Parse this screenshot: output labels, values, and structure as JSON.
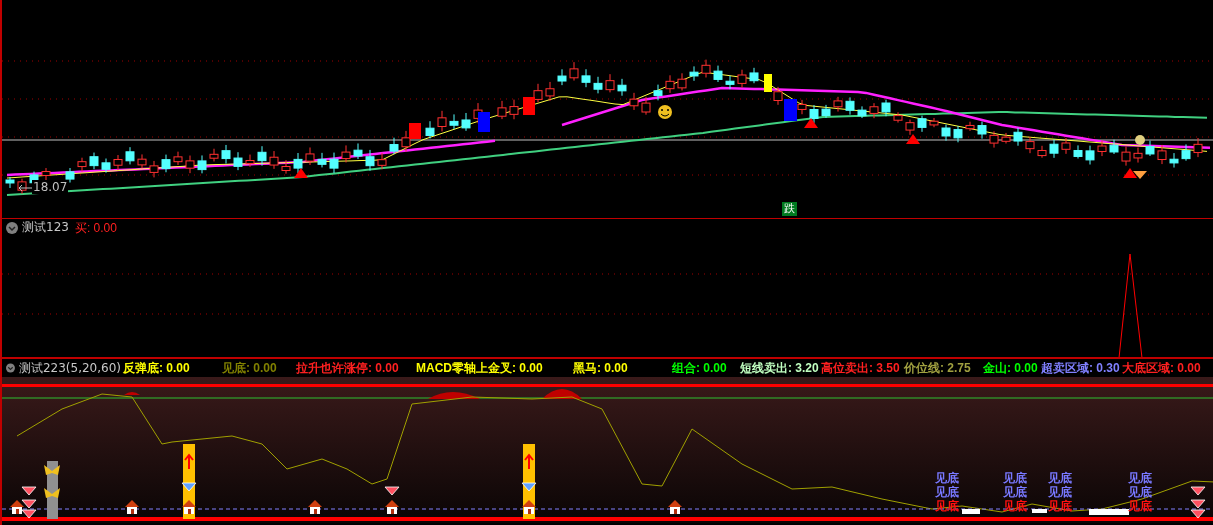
{
  "main_chart": {
    "price_label": "18.07",
    "signal_label": "跌"
  },
  "panels": [
    {
      "title": "测试123",
      "indicators": [
        {
          "text": "买: 0.00",
          "color": "#ff2020"
        }
      ]
    },
    {
      "title": "测试223(5,20,60)",
      "indicators": [
        {
          "text": "反弹底: 0.00",
          "color": "#ffff00"
        },
        {
          "text": "见底: 0.00",
          "color": "#808000"
        },
        {
          "text": "拉升也许涨停: 0.00",
          "color": "#ff2020"
        },
        {
          "text": "MACD零轴上金叉: 0.00",
          "color": "#ffff00"
        },
        {
          "text": "黑马: 0.00",
          "color": "#ffff00"
        },
        {
          "text": "组合: 0.00",
          "color": "#00ff00"
        },
        {
          "text": "短线卖出: 3.20",
          "color": "#c0ffc0"
        },
        {
          "text": "高位卖出: 3.50",
          "color": "#ff2020"
        },
        {
          "text": "价位线: 2.75",
          "color": "#a0a040"
        },
        {
          "text": "金山: 0.00",
          "color": "#00ff00"
        },
        {
          "text": "超卖区域: 0.30",
          "color": "#8080ff"
        },
        {
          "text": "大底区域: 0.00",
          "color": "#ff2020"
        }
      ]
    }
  ],
  "bottom_signals": [
    {
      "labels": [
        {
          "text": "见底",
          "color": "#7878ff"
        },
        {
          "text": "见底",
          "color": "#7878ff"
        },
        {
          "text": "见底",
          "color": "#ff1010"
        }
      ]
    },
    {
      "labels": [
        {
          "text": "见底",
          "color": "#7878ff"
        },
        {
          "text": "见底",
          "color": "#7878ff"
        },
        {
          "text": "见底",
          "color": "#ff1010"
        }
      ]
    },
    {
      "labels": [
        {
          "text": "见底",
          "color": "#7878ff"
        },
        {
          "text": "见底",
          "color": "#7878ff"
        },
        {
          "text": "见底",
          "color": "#ff1010"
        }
      ]
    },
    {
      "labels": [
        {
          "text": "见底",
          "color": "#7878ff"
        },
        {
          "text": "见底",
          "color": "#7878ff"
        },
        {
          "text": "见底",
          "color": "#ff1010"
        }
      ]
    }
  ]
}
